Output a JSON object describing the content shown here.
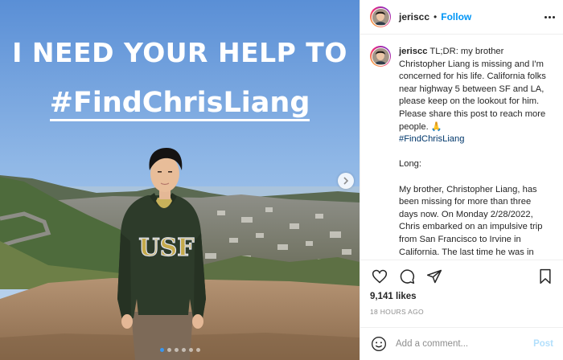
{
  "media": {
    "headline_line1": "I NEED YOUR HELP TO",
    "headline_line2": "#FindChrisLiang",
    "sweatshirt_text": "USF",
    "carousel_dot_count": 6,
    "carousel_active_index": 0
  },
  "header": {
    "username": "jeriscc",
    "separator": "•",
    "follow_label": "Follow",
    "more_icon": "more-horizontal-icon"
  },
  "caption": {
    "username": "jeriscc",
    "intro": "TL;DR: my brother Christopher Liang is missing and I'm concerned for his life. California folks near highway 5 between SF and LA, please keep on the lookout for him. Please share this post to reach more people. 🙏",
    "hashtag": "#FindChrisLiang",
    "long_label": "Long:",
    "body": "My brother, Christopher Liang, has been missing for more than three days now. On Monday 2/28/2022, Chris embarked on an impulsive trip from San Francisco to Irvine in California. The last time he was in contact with anyone was 5 PM PST Monday, and he claimed to be in Firebaugh CA at that time. We knew he was traveling down Highway 5. Since then, his phone has"
  },
  "actions": {
    "like_icon": "heart-icon",
    "comment_icon": "comment-icon",
    "share_icon": "paper-plane-icon",
    "save_icon": "bookmark-icon"
  },
  "likes": "9,141 likes",
  "timestamp": "18 HOURS AGO",
  "comment": {
    "emoji_icon": "smiley-icon",
    "placeholder": "Add a comment...",
    "post_label": "Post"
  },
  "colors": {
    "accent": "#0095f6",
    "hashtag": "#00376b",
    "muted": "#8e8e8e",
    "post_disabled": "#b2dffc"
  }
}
